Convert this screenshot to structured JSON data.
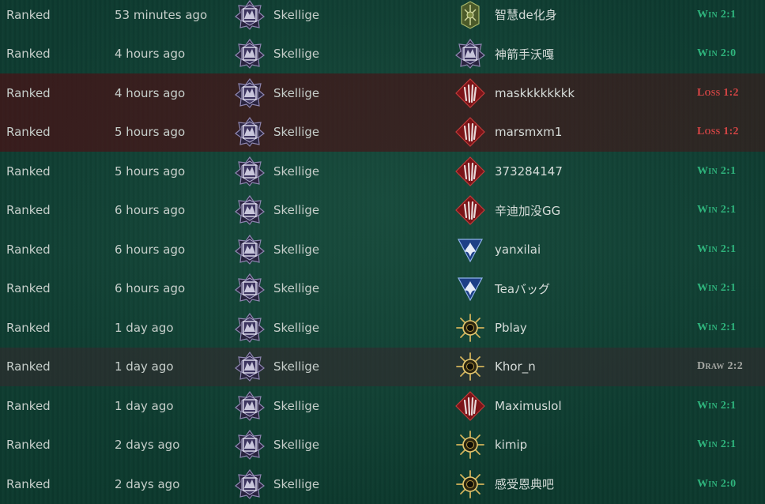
{
  "colors": {
    "win": "#2fb57d",
    "loss": "#d64545",
    "draw": "#a6a9a4",
    "loss_row_bg": "#461216",
    "draw_row_bg": "#37282d",
    "background": "#0f3a30"
  },
  "matches": [
    {
      "mode": "Ranked",
      "time": "53 minutes ago",
      "my_faction": "Skellige",
      "my_faction_icon": "skellige-icon",
      "opponent_faction_icon": "scoiatael-icon",
      "opponent": "智慧de化身",
      "result": "Win",
      "score": "2:1",
      "outcome": "win"
    },
    {
      "mode": "Ranked",
      "time": "4 hours ago",
      "my_faction": "Skellige",
      "my_faction_icon": "skellige-icon",
      "opponent_faction_icon": "skellige-icon",
      "opponent": "神箭手沃嘎",
      "result": "Win",
      "score": "2:0",
      "outcome": "win"
    },
    {
      "mode": "Ranked",
      "time": "4 hours ago",
      "my_faction": "Skellige",
      "my_faction_icon": "skellige-icon",
      "opponent_faction_icon": "monsters-icon",
      "opponent": "maskkkkkkkk",
      "result": "Loss",
      "score": "1:2",
      "outcome": "loss"
    },
    {
      "mode": "Ranked",
      "time": "5 hours ago",
      "my_faction": "Skellige",
      "my_faction_icon": "skellige-icon",
      "opponent_faction_icon": "monsters-icon",
      "opponent": "marsmxm1",
      "result": "Loss",
      "score": "1:2",
      "outcome": "loss"
    },
    {
      "mode": "Ranked",
      "time": "5 hours ago",
      "my_faction": "Skellige",
      "my_faction_icon": "skellige-icon",
      "opponent_faction_icon": "monsters-icon",
      "opponent": "373284147",
      "result": "Win",
      "score": "2:1",
      "outcome": "win"
    },
    {
      "mode": "Ranked",
      "time": "6 hours ago",
      "my_faction": "Skellige",
      "my_faction_icon": "skellige-icon",
      "opponent_faction_icon": "monsters-icon",
      "opponent": "辛迪加没GG",
      "result": "Win",
      "score": "2:1",
      "outcome": "win"
    },
    {
      "mode": "Ranked",
      "time": "6 hours ago",
      "my_faction": "Skellige",
      "my_faction_icon": "skellige-icon",
      "opponent_faction_icon": "northern-realms-icon",
      "opponent": "yanxilai",
      "result": "Win",
      "score": "2:1",
      "outcome": "win"
    },
    {
      "mode": "Ranked",
      "time": "6 hours ago",
      "my_faction": "Skellige",
      "my_faction_icon": "skellige-icon",
      "opponent_faction_icon": "northern-realms-icon",
      "opponent": "Teaバッグ",
      "result": "Win",
      "score": "2:1",
      "outcome": "win"
    },
    {
      "mode": "Ranked",
      "time": "1 day ago",
      "my_faction": "Skellige",
      "my_faction_icon": "skellige-icon",
      "opponent_faction_icon": "nilfgaard-icon",
      "opponent": "Pblay",
      "result": "Win",
      "score": "2:1",
      "outcome": "win"
    },
    {
      "mode": "Ranked",
      "time": "1 day ago",
      "my_faction": "Skellige",
      "my_faction_icon": "skellige-icon",
      "opponent_faction_icon": "nilfgaard-icon",
      "opponent": "Khor_n",
      "result": "Draw",
      "score": "2:2",
      "outcome": "draw"
    },
    {
      "mode": "Ranked",
      "time": "1 day ago",
      "my_faction": "Skellige",
      "my_faction_icon": "skellige-icon",
      "opponent_faction_icon": "monsters-icon",
      "opponent": "Maximuslol",
      "result": "Win",
      "score": "2:1",
      "outcome": "win"
    },
    {
      "mode": "Ranked",
      "time": "2 days ago",
      "my_faction": "Skellige",
      "my_faction_icon": "skellige-icon",
      "opponent_faction_icon": "nilfgaard-icon",
      "opponent": "kimip",
      "result": "Win",
      "score": "2:1",
      "outcome": "win"
    },
    {
      "mode": "Ranked",
      "time": "2 days ago",
      "my_faction": "Skellige",
      "my_faction_icon": "skellige-icon",
      "opponent_faction_icon": "nilfgaard-icon",
      "opponent": "感受恩典吧",
      "result": "Win",
      "score": "2:0",
      "outcome": "win"
    }
  ]
}
